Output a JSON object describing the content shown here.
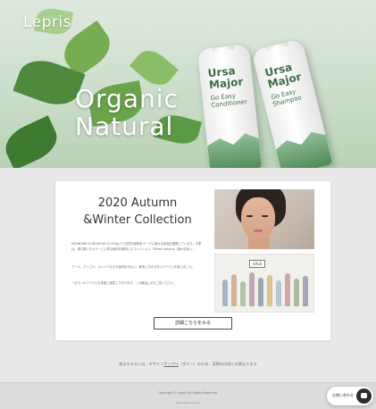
{
  "hero": {
    "brand": "Lepris",
    "headline_line1": "Organic",
    "headline_line2": "Natural",
    "bottles": [
      {
        "name_line1": "Ursa",
        "name_line2": "Major",
        "type_line1": "Go Easy",
        "type_line2": "Conditioner"
      },
      {
        "name_line1": "Ursa",
        "name_line2": "Major",
        "type_line1": "Go Easy",
        "type_line2": "Shampoo"
      }
    ],
    "bottle_color": "#3e6d48",
    "leaf_color": "#5f9b47"
  },
  "collection": {
    "title_line1": "2020 Autumn",
    "title_line2": "&Winter Collection",
    "paragraph1": "MOUNTAIN & MEADOW CLOTHは人と自然の調和をテーマに様々な商品を展開しています。今季は、落ち着いたカラーと上質な素材を使用したコレクション「Silent Autumn（静かな秋）」。",
    "paragraph2": "ウール、アンゴラ、カシミヤなどの素材を中心に、秋冬に欠かせないアイテムを揃えました。",
    "paragraph3": "一点モノのアイテムも多数ご用意しております。この機会にぜひご覧ください。",
    "illustration_sign": "SALE",
    "cta_label": "詳細こちらをみる"
  },
  "notice": {
    "text_before": "表示テキストは、デザイン",
    "link_text": "サンプル",
    "text_after": "（ダミー）のため、実際の内容とは異なります"
  },
  "footer": {
    "copyright": "Copyright © Lepris All Rights Reserved.",
    "powered_by": "Powered by Lepris"
  },
  "chat_widget": {
    "label": "お問い合わせ"
  }
}
